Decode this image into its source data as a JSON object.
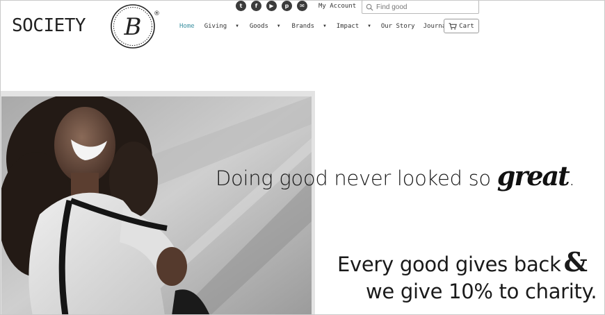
{
  "logo": {
    "wordmark": "SOCIETY",
    "badge_letter": "B",
    "reg_mark": "®"
  },
  "social": [
    {
      "name": "twitter-icon",
      "glyph": "t"
    },
    {
      "name": "facebook-icon",
      "glyph": "f"
    },
    {
      "name": "youtube-icon",
      "glyph": "▶"
    },
    {
      "name": "pinterest-icon",
      "glyph": "p"
    },
    {
      "name": "email-icon",
      "glyph": "✉"
    }
  ],
  "account": {
    "label": "My Account"
  },
  "search": {
    "placeholder": "Find good",
    "icon": "search-icon"
  },
  "nav": {
    "items": [
      {
        "label": "Home",
        "active": true,
        "dropdown": false
      },
      {
        "label": "Giving",
        "active": false,
        "dropdown": true
      },
      {
        "label": "Goods",
        "active": false,
        "dropdown": true
      },
      {
        "label": "Brands",
        "active": false,
        "dropdown": true
      },
      {
        "label": "Impact",
        "active": false,
        "dropdown": true
      },
      {
        "label": "Our Story",
        "active": false,
        "dropdown": false
      },
      {
        "label": "Journal",
        "active": false,
        "dropdown": false
      }
    ],
    "caret": "▼"
  },
  "cart": {
    "label": "Cart",
    "icon": "cart-icon"
  },
  "hero": {
    "headline_prefix": "Doing good never looked so ",
    "headline_accent": "great",
    "headline_suffix": ".",
    "subline_1": "Every good gives back",
    "subline_ampersand": "&",
    "subline_2": "we give 10% to charity."
  },
  "colors": {
    "accent": "#3a8fa0",
    "text": "#1a1a1a",
    "icon": "#3b3b3b"
  }
}
